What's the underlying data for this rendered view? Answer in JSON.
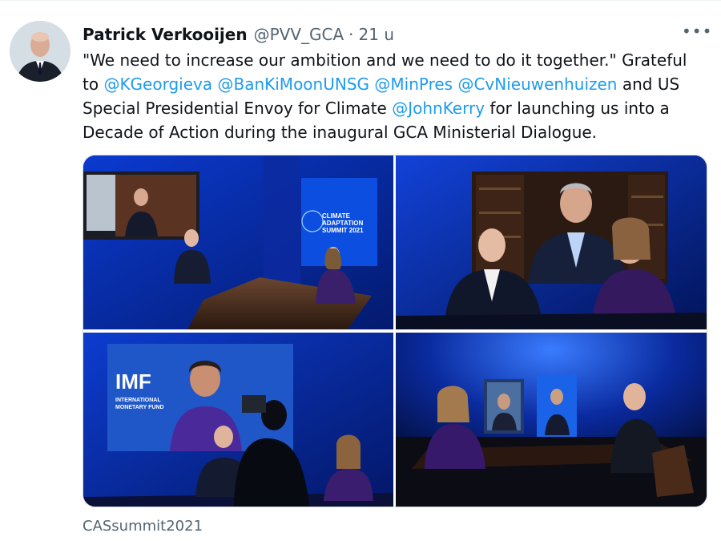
{
  "tweet": {
    "author_name": "Patrick Verkooijen",
    "handle": "@PVV_GCA",
    "separator": "·",
    "time": "21 u",
    "more_label": "•••",
    "text_parts": {
      "t1": "\"We need to increase our ambition and we need to do it together.\" Grateful\nto ",
      "m1": "@KGeorgieva",
      "t2": " ",
      "m2": "@BanKiMoonUNSG",
      "t3": " ",
      "m3": "@MinPres",
      "t4": " ",
      "m4": "@CvNieuwenhuizen",
      "t5": " and US\nSpecial Presidential Envoy for Climate ",
      "m5": "@JohnKerry",
      "t6": " for launching us into a\nDecade of Action during the inaugural GCA Ministerial Dialogue."
    },
    "media_alt": {
      "photo1_screen_text": [
        "CLIMATE",
        "ADAPTATION",
        "SUMMIT 2021"
      ],
      "photo3_screen_text": [
        "IMF",
        "INTERNATIONAL",
        "MONETARY FUND"
      ]
    },
    "footer_tag": "CASsummit2021"
  },
  "colors": {
    "mention": "#1d9bf0",
    "secondary_text": "#536471",
    "studio_blue": "#0a2fb0"
  }
}
